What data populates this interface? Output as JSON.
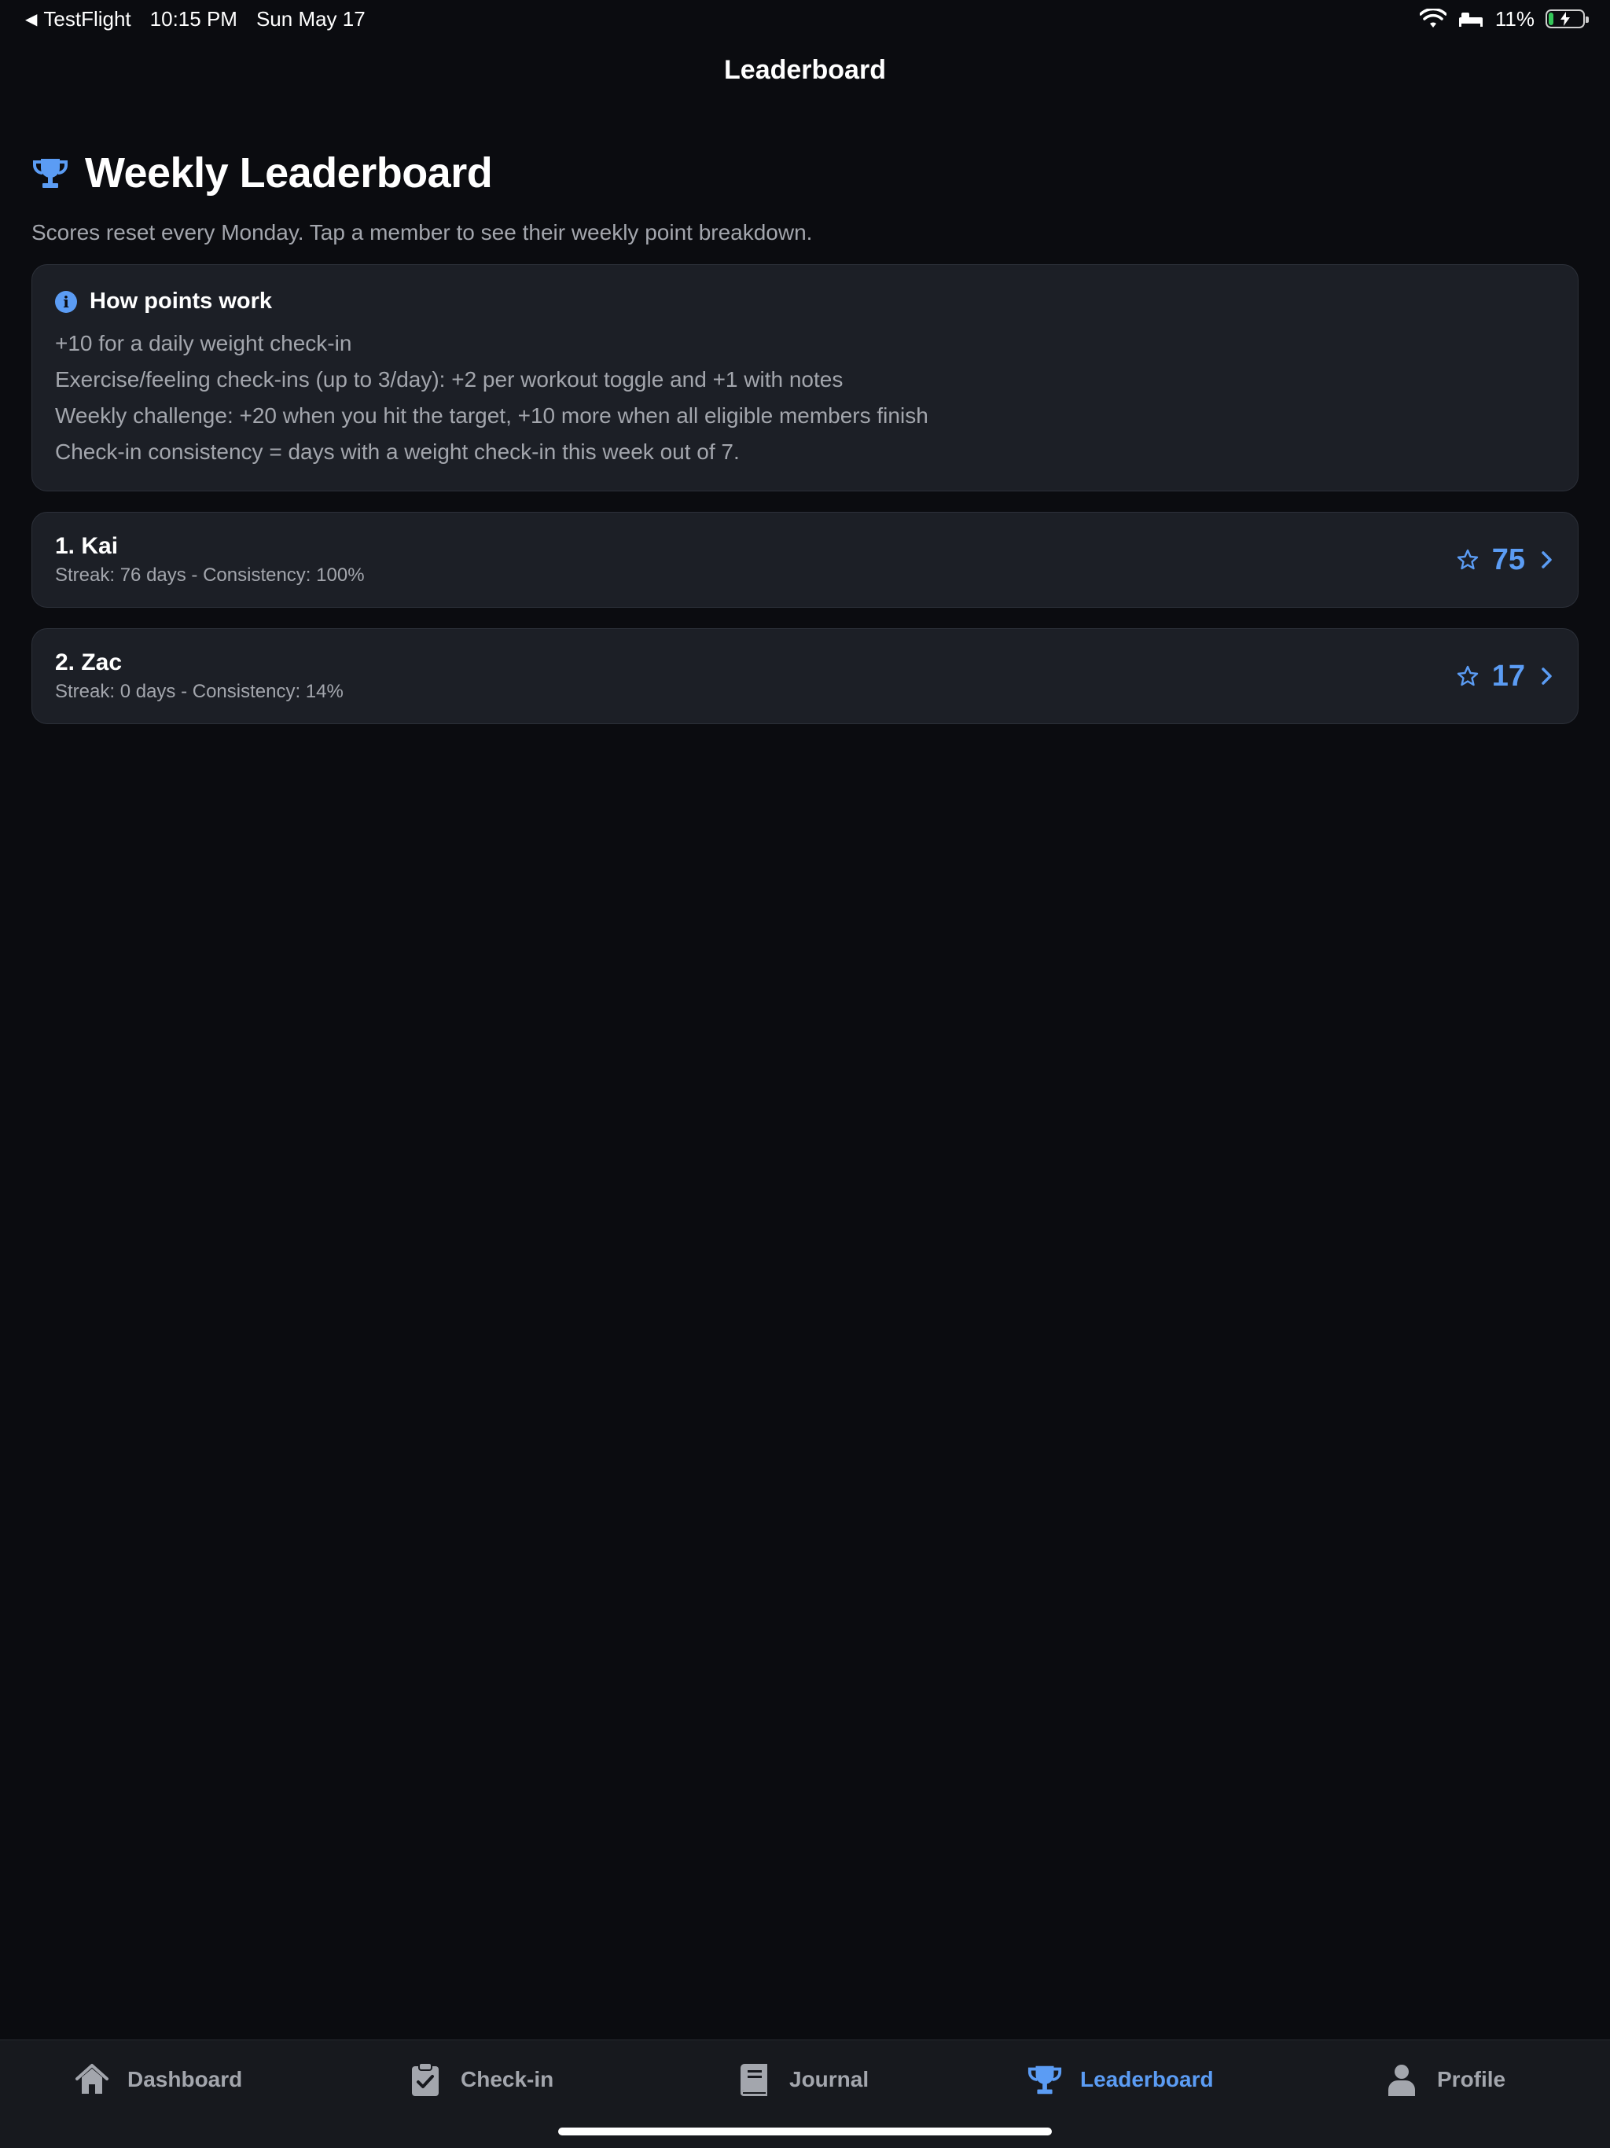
{
  "status_bar": {
    "back_app": "TestFlight",
    "time": "10:15 PM",
    "date": "Sun May 17",
    "battery": "11%"
  },
  "nav": {
    "title": "Leaderboard"
  },
  "header": {
    "title": "Weekly Leaderboard",
    "subtitle": "Scores reset every Monday. Tap a member to see their weekly point breakdown."
  },
  "info": {
    "title": "How points work",
    "lines": [
      "+10 for a daily weight check-in",
      "Exercise/feeling check-ins (up to 3/day): +2 per workout toggle and +1 with notes",
      "Weekly challenge: +20 when you hit the target, +10 more when all eligible members finish",
      "Check-in consistency = days with a weight check-in this week out of 7."
    ]
  },
  "members": [
    {
      "name": "1. Kai",
      "stats": "Streak: 76 days - Consistency: 100%",
      "score": "75"
    },
    {
      "name": "2. Zac",
      "stats": "Streak: 0 days - Consistency: 14%",
      "score": "17"
    }
  ],
  "tabs": [
    {
      "label": "Dashboard",
      "icon": "home-icon"
    },
    {
      "label": "Check-in",
      "icon": "clipboard-check-icon"
    },
    {
      "label": "Journal",
      "icon": "book-icon"
    },
    {
      "label": "Leaderboard",
      "icon": "trophy-icon",
      "active": true
    },
    {
      "label": "Profile",
      "icon": "person-icon"
    }
  ],
  "colors": {
    "background": "#0b0c10",
    "card": "#1c1f26",
    "accent": "#5b9cf4",
    "muted_text": "#a3a6ad"
  }
}
